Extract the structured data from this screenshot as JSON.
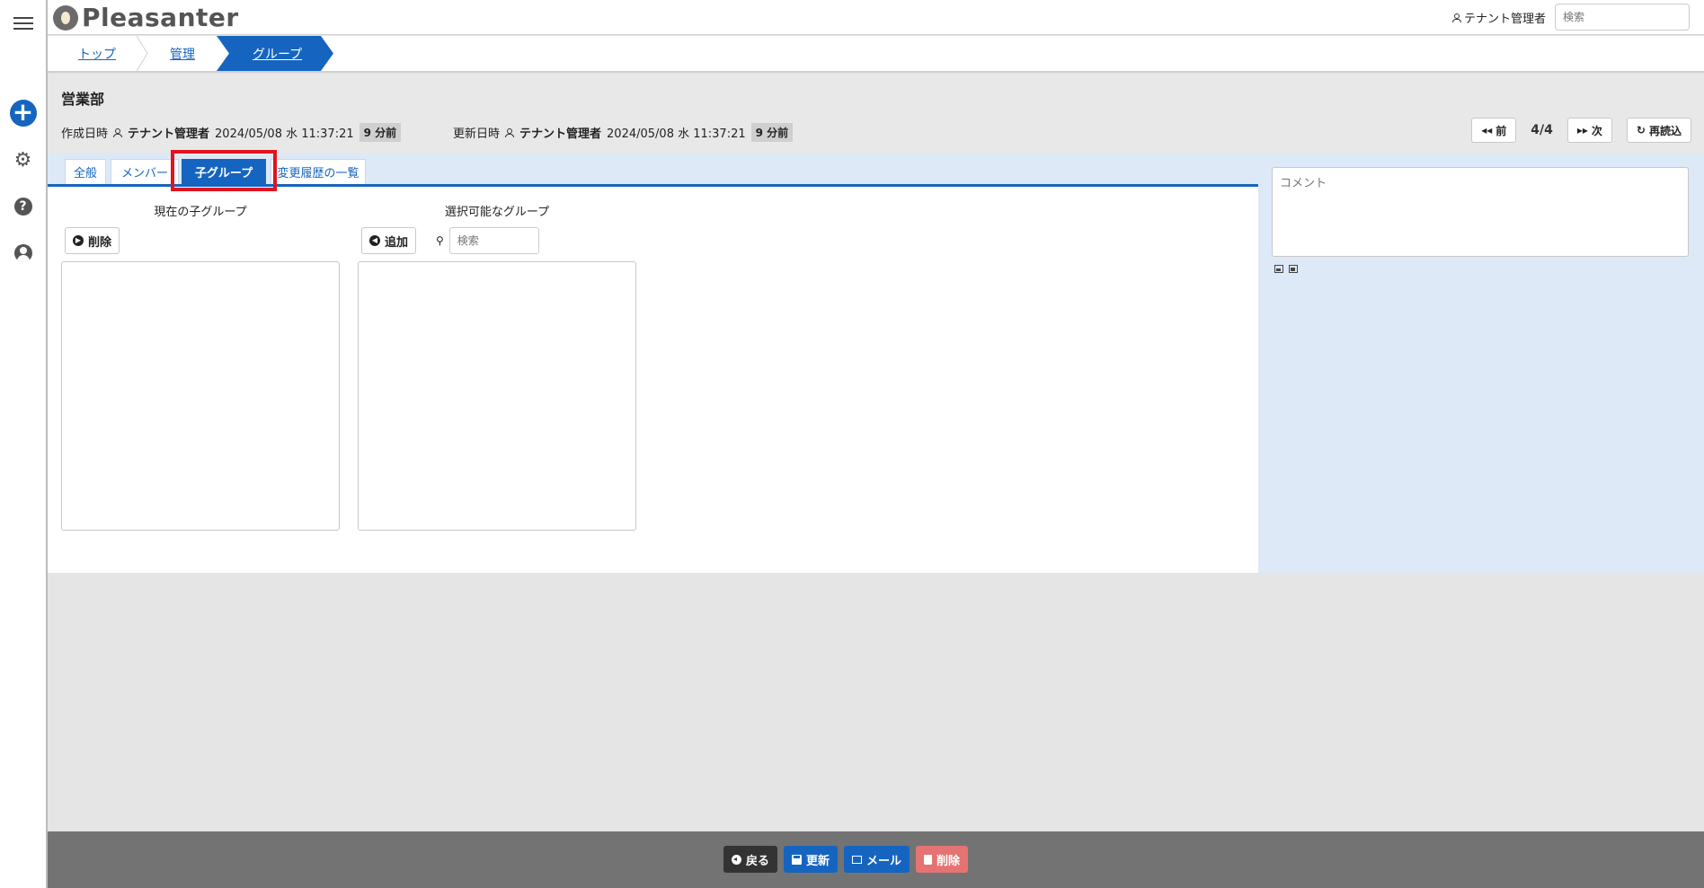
{
  "app": {
    "name": "Pleasanter"
  },
  "header": {
    "user_name": "テナント管理者",
    "search_placeholder": "検索"
  },
  "breadcrumb": [
    {
      "label": "トップ"
    },
    {
      "label": "管理"
    },
    {
      "label": "グループ"
    }
  ],
  "record": {
    "title": "営業部",
    "created_label": "作成日時",
    "created_by": "テナント管理者",
    "created_at": "2024/05/08 水 11:37:21",
    "created_elapsed": "9 分前",
    "updated_label": "更新日時",
    "updated_by": "テナント管理者",
    "updated_at": "2024/05/08 水 11:37:21",
    "updated_elapsed": "9 分前"
  },
  "navigation": {
    "prev_label": "前",
    "page_count": "4/4",
    "next_label": "次",
    "reload_label": "再読込"
  },
  "tabs": [
    {
      "label": "全般"
    },
    {
      "label": "メンバー"
    },
    {
      "label": "子グループ",
      "active": true
    },
    {
      "label": "変更履歴の一覧"
    }
  ],
  "child_groups": {
    "current_label": "現在の子グループ",
    "delete_label": "削除",
    "available_label": "選択可能なグループ",
    "add_label": "追加",
    "search_placeholder": "検索"
  },
  "comment": {
    "placeholder": "コメント"
  },
  "footer": {
    "back_label": "戻る",
    "update_label": "更新",
    "mail_label": "メール",
    "delete_label": "削除"
  },
  "colors": {
    "accent": "#1565c0",
    "highlight": "#e0141e",
    "danger": "#e57373",
    "panel_bg": "#dde9f7"
  }
}
